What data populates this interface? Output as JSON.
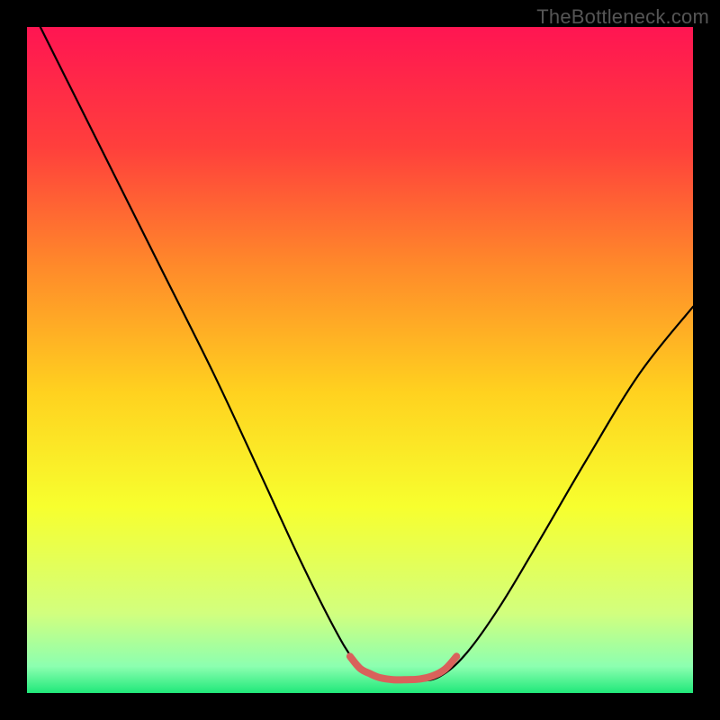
{
  "watermark": "TheBottleneck.com",
  "chart_data": {
    "type": "line",
    "title": "",
    "xlabel": "",
    "ylabel": "",
    "xlim": [
      0,
      100
    ],
    "ylim": [
      0,
      100
    ],
    "grid": false,
    "legend": false,
    "background_gradient_stops": [
      {
        "offset": 0.0,
        "color": "#ff1552"
      },
      {
        "offset": 0.18,
        "color": "#ff3f3c"
      },
      {
        "offset": 0.36,
        "color": "#ff8a2a"
      },
      {
        "offset": 0.55,
        "color": "#ffd21f"
      },
      {
        "offset": 0.72,
        "color": "#f7ff2e"
      },
      {
        "offset": 0.88,
        "color": "#d2ff7e"
      },
      {
        "offset": 0.96,
        "color": "#8cffb0"
      },
      {
        "offset": 1.0,
        "color": "#20e87a"
      }
    ],
    "series": [
      {
        "name": "bottleneck-curve",
        "stroke": "#000000",
        "stroke_width": 2.2,
        "points": [
          {
            "x": 2.0,
            "y": 100.0
          },
          {
            "x": 6.0,
            "y": 92.0
          },
          {
            "x": 12.0,
            "y": 80.0
          },
          {
            "x": 20.0,
            "y": 64.0
          },
          {
            "x": 28.0,
            "y": 48.0
          },
          {
            "x": 35.0,
            "y": 33.0
          },
          {
            "x": 41.0,
            "y": 20.0
          },
          {
            "x": 46.0,
            "y": 10.0
          },
          {
            "x": 49.0,
            "y": 5.0
          },
          {
            "x": 51.5,
            "y": 2.5
          },
          {
            "x": 55.0,
            "y": 1.8
          },
          {
            "x": 58.5,
            "y": 1.8
          },
          {
            "x": 62.0,
            "y": 2.5
          },
          {
            "x": 66.0,
            "y": 6.0
          },
          {
            "x": 71.0,
            "y": 13.0
          },
          {
            "x": 77.0,
            "y": 23.0
          },
          {
            "x": 84.0,
            "y": 35.0
          },
          {
            "x": 92.0,
            "y": 48.0
          },
          {
            "x": 100.0,
            "y": 58.0
          }
        ]
      },
      {
        "name": "optimal-zone-marker",
        "stroke": "#d9615b",
        "stroke_width": 8,
        "linecap": "round",
        "points": [
          {
            "x": 48.5,
            "y": 5.5
          },
          {
            "x": 50.0,
            "y": 3.7
          },
          {
            "x": 51.5,
            "y": 2.9
          },
          {
            "x": 53.0,
            "y": 2.3
          },
          {
            "x": 55.0,
            "y": 2.0
          },
          {
            "x": 57.0,
            "y": 2.0
          },
          {
            "x": 59.0,
            "y": 2.1
          },
          {
            "x": 61.0,
            "y": 2.6
          },
          {
            "x": 62.8,
            "y": 3.6
          },
          {
            "x": 64.5,
            "y": 5.5
          }
        ]
      }
    ]
  }
}
